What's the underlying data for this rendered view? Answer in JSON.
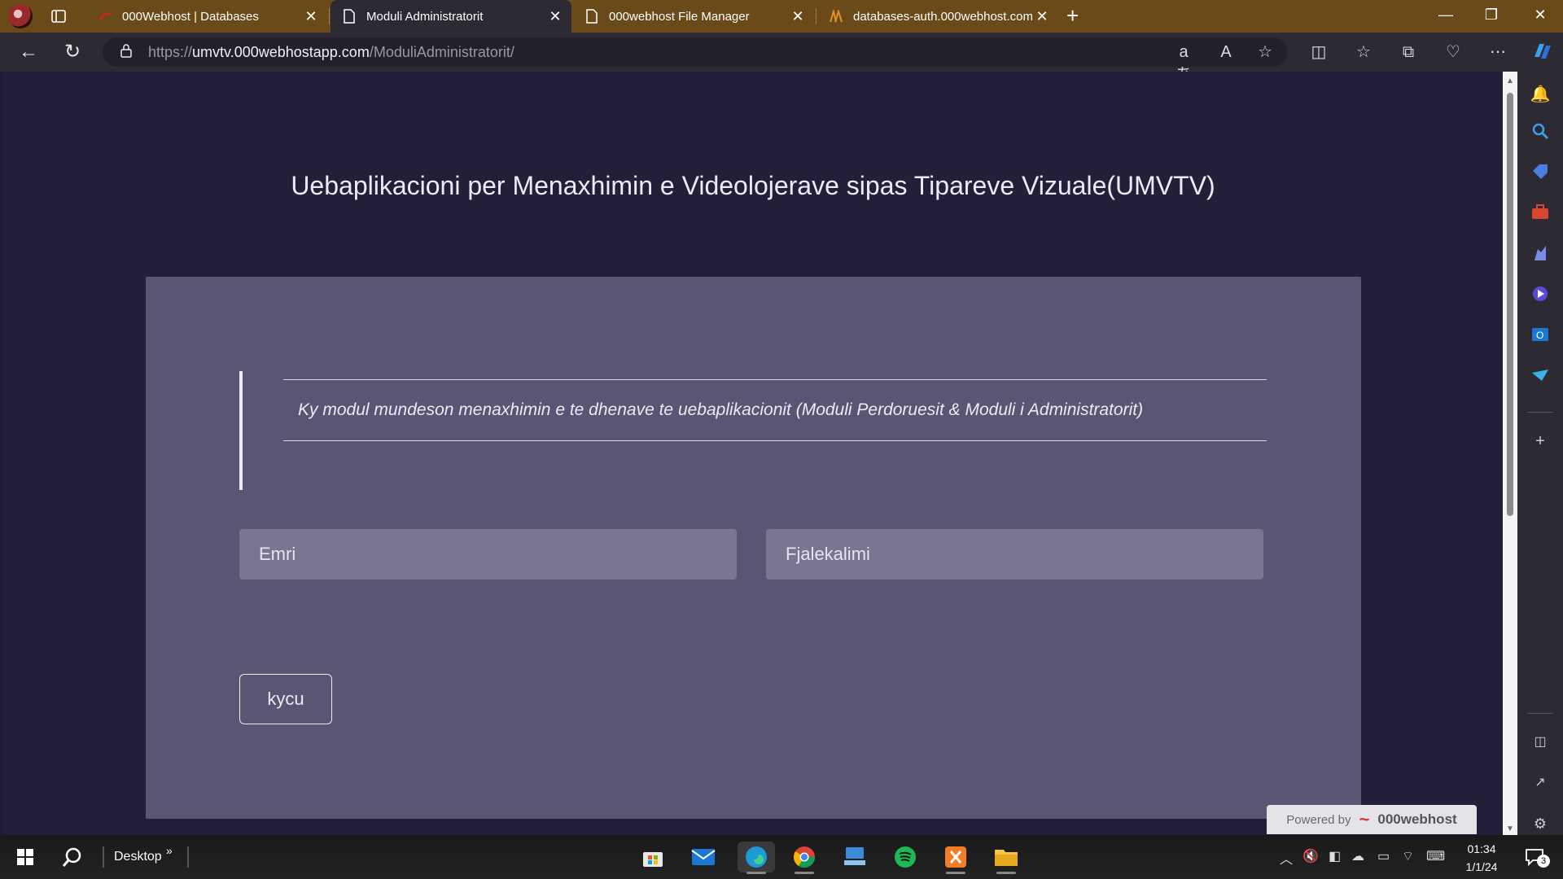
{
  "browser": {
    "tabs": [
      {
        "label": "000Webhost | Databases",
        "icon": "webhost-icon"
      },
      {
        "label": "Moduli Administratorit",
        "icon": "document-icon",
        "active": true
      },
      {
        "label": "000webhost File Manager",
        "icon": "document-icon"
      },
      {
        "label": "databases-auth.000webhost.com",
        "icon": "pma-icon"
      }
    ],
    "url": {
      "prefix": "https://",
      "host": "umvtv.000webhostapp.com",
      "path": "/ModuliAdministratorit/"
    }
  },
  "page": {
    "title": "Uebaplikacioni per Menaxhimin e Videolojerave sipas Tipareve Vizuale(UMVTV)",
    "description": "Ky modul mundeson menaxhimin e te dhenave te uebaplikacionit (Moduli Perdoruesit & Moduli i Administratorit)",
    "username_placeholder": "Emri",
    "password_placeholder": "Fjalekalimi",
    "login_label": "kycu",
    "powered_by": "Powered by",
    "brand": "000webhost"
  },
  "taskbar": {
    "desktop_label": "Desktop",
    "time": "01:34",
    "date": "1/1/24",
    "notifications": "3"
  },
  "colors": {
    "page_bg": "#231f38",
    "card_bg": "#5b5573",
    "input_bg": "#7a7590",
    "tabstrip_bg": "#6b4a1a"
  }
}
